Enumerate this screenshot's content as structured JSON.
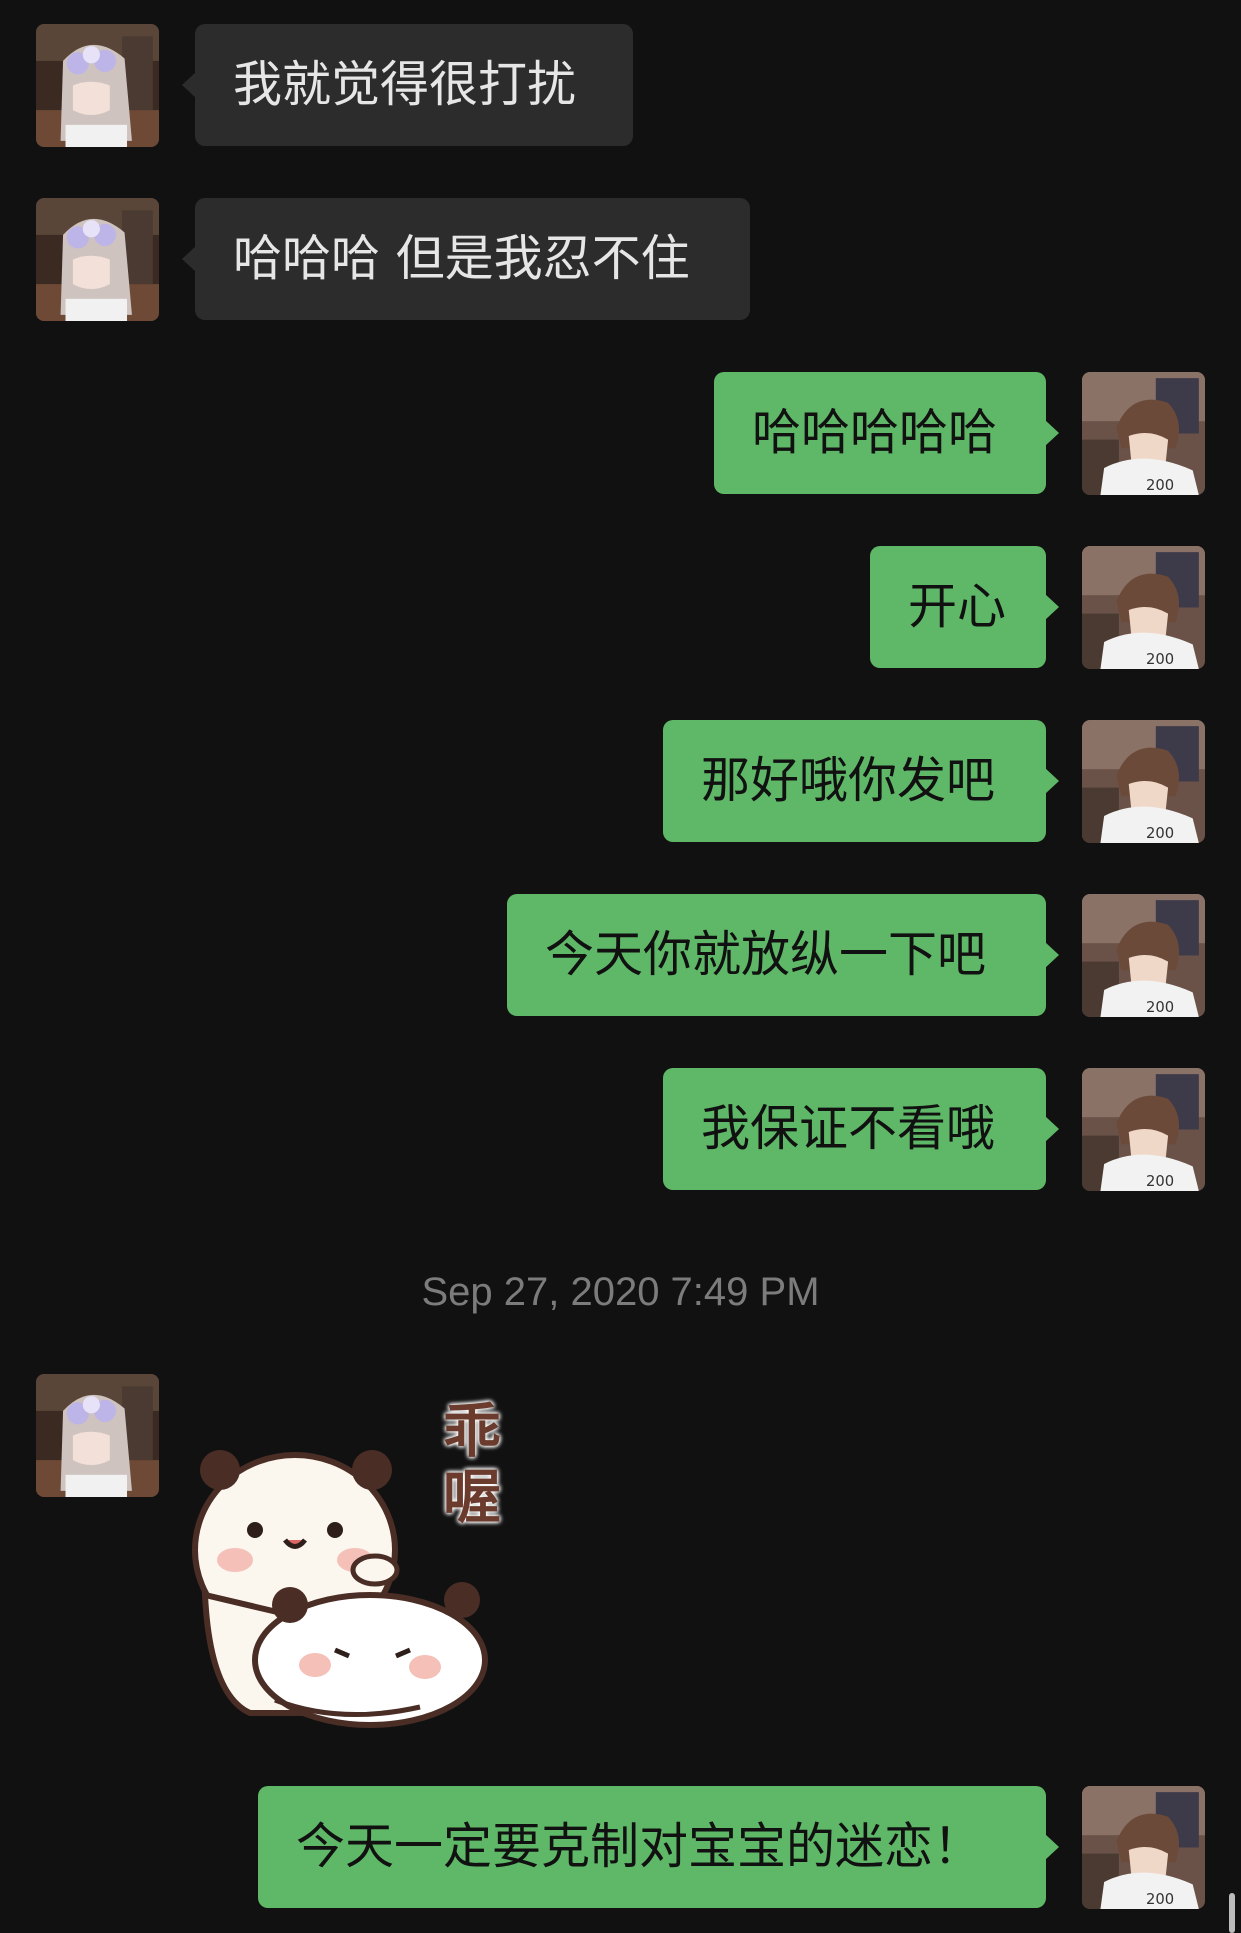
{
  "messages": [
    {
      "side": "in",
      "text": "我就觉得很打扰"
    },
    {
      "side": "in",
      "text": "哈哈哈 但是我忍不住"
    },
    {
      "side": "out",
      "text": "哈哈哈哈哈"
    },
    {
      "side": "out",
      "text": "开心"
    },
    {
      "side": "out",
      "text": "那好哦你发吧"
    },
    {
      "side": "out",
      "text": "今天你就放纵一下吧"
    },
    {
      "side": "out",
      "text": "我保证不看哦"
    },
    {
      "side": "out",
      "text": "今天一定要克制对宝宝的迷恋！"
    }
  ],
  "timestamp": "Sep 27, 2020 7:49 PM",
  "sticker": {
    "text": "乖喔",
    "icon": "panda-sticker"
  },
  "avatars": {
    "incoming": "girl-avatar",
    "outgoing": "boy-avatar"
  },
  "colors": {
    "background": "#111111",
    "incoming_bubble": "#2c2c2c",
    "outgoing_bubble": "#5fb868"
  }
}
